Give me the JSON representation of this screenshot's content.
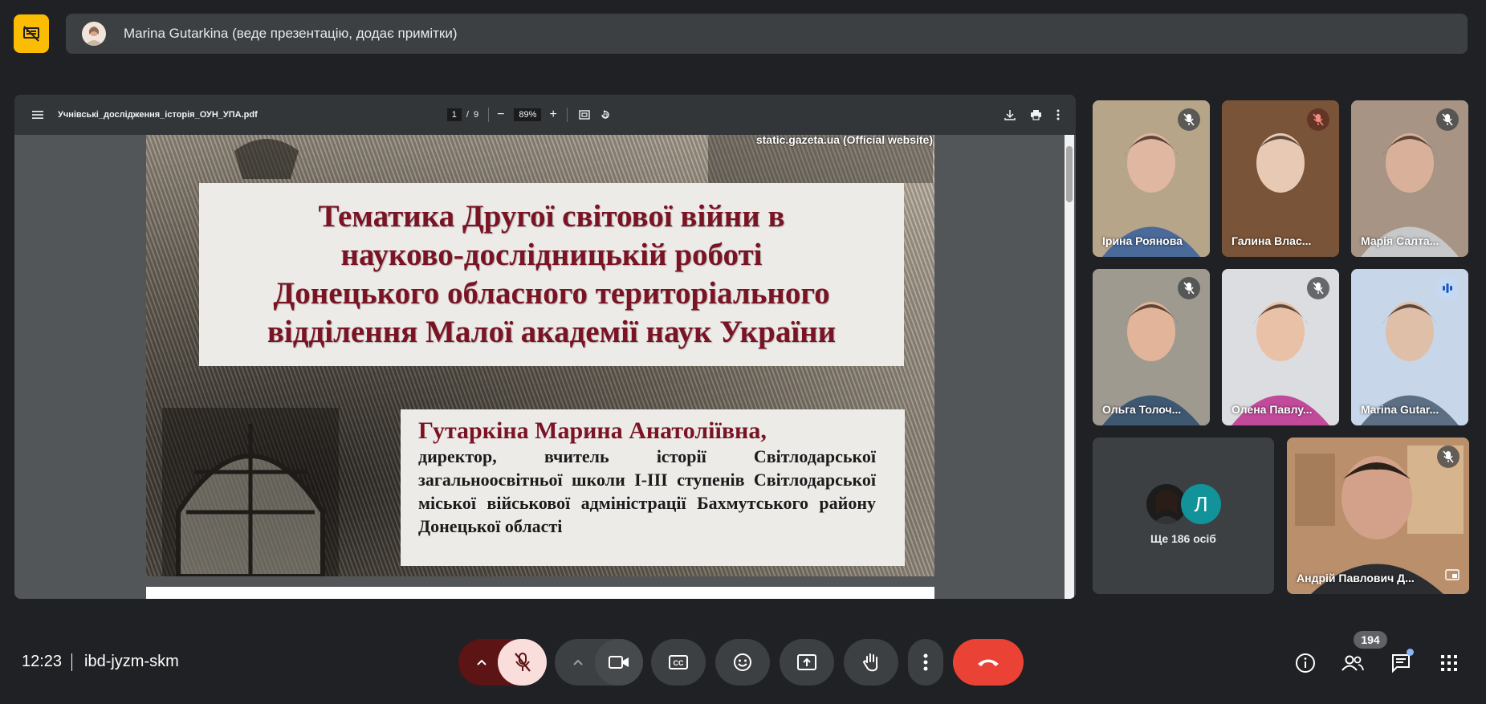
{
  "presenter_bar": {
    "name": "Marina Gutarkina (веде презентацію, додає примітки)"
  },
  "pdf_viewer": {
    "filename": "Учнівські_дослідження_історія_ОУН_УПА.pdf",
    "page_current": "1",
    "page_separator": "/",
    "page_total": "9",
    "zoom": "89%",
    "zoom_out": "−",
    "zoom_in": "+"
  },
  "slide": {
    "source": "static.gazeta.ua (Official website)",
    "title_lines": [
      "Тематика Другої світової війни в",
      "науково-дослідницькій роботі",
      "Донецького обласного територіального",
      "відділення Малої академії наук України"
    ],
    "author_name": "Гутаркіна Марина Анатоліївна,",
    "author_description": "директор, вчитель історії Світлодарської загальноосвітньої школи І-ІІІ ступенів Світлодарської міської військової адміністрації Бахмутського району Донецької області"
  },
  "participants": [
    {
      "name": "Ірина Роянова",
      "bg": "#b7a58a",
      "shirt": "#4a6a9a",
      "face": "#e0b7a0",
      "mic": "off"
    },
    {
      "name": "Галина Влас...",
      "bg": "#7a5438",
      "shirt": "#7a5438",
      "face": "#e8cab4",
      "mic": "off-red"
    },
    {
      "name": "Марія Салта...",
      "bg": "#a79484",
      "shirt": "#c7c8c9",
      "face": "#d9b19a",
      "mic": "off"
    },
    {
      "name": "Ольга Толоч...",
      "bg": "#9f9a90",
      "shirt": "#3e5872",
      "face": "#e2b49a",
      "mic": "off"
    },
    {
      "name": "Олена Павлу...",
      "bg": "#dcdde0",
      "shirt": "#c24a9b",
      "face": "#e9c1a7",
      "mic": "off"
    },
    {
      "name": "Marina Gutar...",
      "bg": "#c7d6e8",
      "shirt": "#5d6f84",
      "face": "#e0bfa9",
      "mic": "speaking"
    }
  ],
  "more_people": {
    "avatar_letter": "Л",
    "label": "Ще 186 осіб"
  },
  "self_tile": {
    "name": "Андрій Павлович Д..."
  },
  "bottom_bar": {
    "time": "12:23",
    "separator": "|",
    "meeting_code": "ibd-jyzm-skm",
    "participant_count": "194"
  },
  "colors": {
    "background": "#202124",
    "accent_yellow": "#fbbc04",
    "end_call": "#ea4335",
    "mic_muted_bg": "#f9dedc"
  }
}
